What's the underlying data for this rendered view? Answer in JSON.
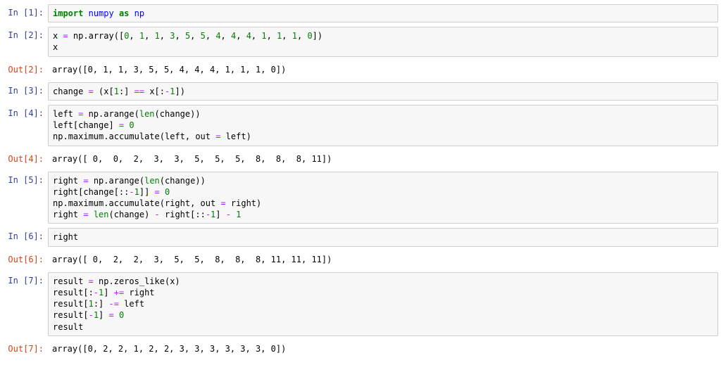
{
  "cells": {
    "c1": {
      "in_prompt": "In [1]:",
      "code": ""
    },
    "c2": {
      "in_prompt": "In [2]:",
      "code": "",
      "out_prompt": "Out[2]:",
      "out": "array([0, 1, 1, 3, 5, 5, 4, 4, 4, 1, 1, 1, 0])"
    },
    "c3": {
      "in_prompt": "In [3]:",
      "code": ""
    },
    "c4": {
      "in_prompt": "In [4]:",
      "code": "",
      "out_prompt": "Out[4]:",
      "out": "array([ 0,  0,  2,  3,  3,  5,  5,  5,  8,  8,  8, 11])"
    },
    "c5": {
      "in_prompt": "In [5]:",
      "code": ""
    },
    "c6": {
      "in_prompt": "In [6]:",
      "code": "",
      "out_prompt": "Out[6]:",
      "out": "array([ 0,  2,  2,  3,  5,  5,  8,  8,  8, 11, 11, 11])"
    },
    "c7": {
      "in_prompt": "In [7]:",
      "code": "",
      "out_prompt": "Out[7]:",
      "out": "array([0, 2, 2, 1, 2, 2, 3, 3, 3, 3, 3, 3, 0])"
    }
  },
  "code_tokens": {
    "c1": [
      {
        "t": "import",
        "c": "kw"
      },
      {
        "t": " "
      },
      {
        "t": "numpy",
        "c": "nn"
      },
      {
        "t": " "
      },
      {
        "t": "as",
        "c": "kw"
      },
      {
        "t": " "
      },
      {
        "t": "np",
        "c": "nn"
      }
    ],
    "c2": [
      {
        "t": "x "
      },
      {
        "t": "=",
        "c": "op"
      },
      {
        "t": " np"
      },
      {
        "t": "."
      },
      {
        "t": "array(["
      },
      {
        "t": "0",
        "c": "num"
      },
      {
        "t": ", "
      },
      {
        "t": "1",
        "c": "num"
      },
      {
        "t": ", "
      },
      {
        "t": "1",
        "c": "num"
      },
      {
        "t": ", "
      },
      {
        "t": "3",
        "c": "num"
      },
      {
        "t": ", "
      },
      {
        "t": "5",
        "c": "num"
      },
      {
        "t": ", "
      },
      {
        "t": "5",
        "c": "num"
      },
      {
        "t": ", "
      },
      {
        "t": "4",
        "c": "num"
      },
      {
        "t": ", "
      },
      {
        "t": "4",
        "c": "num"
      },
      {
        "t": ", "
      },
      {
        "t": "4",
        "c": "num"
      },
      {
        "t": ", "
      },
      {
        "t": "1",
        "c": "num"
      },
      {
        "t": ", "
      },
      {
        "t": "1",
        "c": "num"
      },
      {
        "t": ", "
      },
      {
        "t": "1",
        "c": "num"
      },
      {
        "t": ", "
      },
      {
        "t": "0",
        "c": "num"
      },
      {
        "t": "])"
      },
      {
        "t": "\n"
      },
      {
        "t": "x"
      }
    ],
    "c3": [
      {
        "t": "change "
      },
      {
        "t": "=",
        "c": "op"
      },
      {
        "t": " (x["
      },
      {
        "t": "1",
        "c": "num"
      },
      {
        "t": ":] "
      },
      {
        "t": "==",
        "c": "op"
      },
      {
        "t": " x[:"
      },
      {
        "t": "-",
        "c": "op"
      },
      {
        "t": "1",
        "c": "num"
      },
      {
        "t": "])"
      }
    ],
    "c4": [
      {
        "t": "left "
      },
      {
        "t": "=",
        "c": "op"
      },
      {
        "t": " np"
      },
      {
        "t": "."
      },
      {
        "t": "arange("
      },
      {
        "t": "len",
        "c": "bi"
      },
      {
        "t": "(change))"
      },
      {
        "t": "\n"
      },
      {
        "t": "left[change] "
      },
      {
        "t": "=",
        "c": "op"
      },
      {
        "t": " "
      },
      {
        "t": "0",
        "c": "num"
      },
      {
        "t": "\n"
      },
      {
        "t": "np"
      },
      {
        "t": "."
      },
      {
        "t": "maximum"
      },
      {
        "t": "."
      },
      {
        "t": "accumulate(left, out "
      },
      {
        "t": "=",
        "c": "op"
      },
      {
        "t": " left)"
      }
    ],
    "c5": [
      {
        "t": "right "
      },
      {
        "t": "=",
        "c": "op"
      },
      {
        "t": " np"
      },
      {
        "t": "."
      },
      {
        "t": "arange("
      },
      {
        "t": "len",
        "c": "bi"
      },
      {
        "t": "(change))"
      },
      {
        "t": "\n"
      },
      {
        "t": "right[change[::"
      },
      {
        "t": "-",
        "c": "op"
      },
      {
        "t": "1",
        "c": "num"
      },
      {
        "t": "]] "
      },
      {
        "t": "=",
        "c": "op"
      },
      {
        "t": " "
      },
      {
        "t": "0",
        "c": "num"
      },
      {
        "t": "\n"
      },
      {
        "t": "np"
      },
      {
        "t": "."
      },
      {
        "t": "maximum"
      },
      {
        "t": "."
      },
      {
        "t": "accumulate(right, out "
      },
      {
        "t": "=",
        "c": "op"
      },
      {
        "t": " right)"
      },
      {
        "t": "\n"
      },
      {
        "t": "right "
      },
      {
        "t": "=",
        "c": "op"
      },
      {
        "t": " "
      },
      {
        "t": "len",
        "c": "bi"
      },
      {
        "t": "(change) "
      },
      {
        "t": "-",
        "c": "op"
      },
      {
        "t": " right[::"
      },
      {
        "t": "-",
        "c": "op"
      },
      {
        "t": "1",
        "c": "num"
      },
      {
        "t": "] "
      },
      {
        "t": "-",
        "c": "op"
      },
      {
        "t": " "
      },
      {
        "t": "1",
        "c": "num"
      }
    ],
    "c6": [
      {
        "t": "right"
      }
    ],
    "c7": [
      {
        "t": "result "
      },
      {
        "t": "=",
        "c": "op"
      },
      {
        "t": " np"
      },
      {
        "t": "."
      },
      {
        "t": "zeros_like(x)"
      },
      {
        "t": "\n"
      },
      {
        "t": "result[:"
      },
      {
        "t": "-",
        "c": "op"
      },
      {
        "t": "1",
        "c": "num"
      },
      {
        "t": "] "
      },
      {
        "t": "+=",
        "c": "op"
      },
      {
        "t": " right"
      },
      {
        "t": "\n"
      },
      {
        "t": "result["
      },
      {
        "t": "1",
        "c": "num"
      },
      {
        "t": ":] "
      },
      {
        "t": "-=",
        "c": "op"
      },
      {
        "t": " left"
      },
      {
        "t": "\n"
      },
      {
        "t": "result["
      },
      {
        "t": "-",
        "c": "op"
      },
      {
        "t": "1",
        "c": "num"
      },
      {
        "t": "] "
      },
      {
        "t": "=",
        "c": "op"
      },
      {
        "t": " "
      },
      {
        "t": "0",
        "c": "num"
      },
      {
        "t": "\n"
      },
      {
        "t": "result"
      }
    ]
  }
}
